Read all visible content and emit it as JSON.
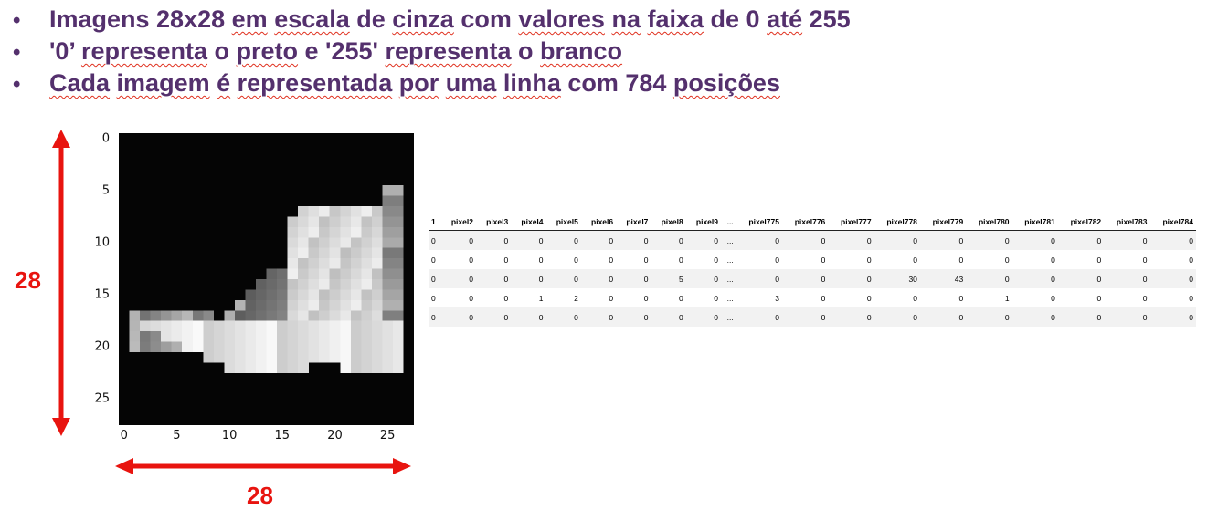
{
  "bullets": [
    {
      "marker": "•",
      "segments": [
        {
          "text": "Imagens 28x28 ",
          "flag": false
        },
        {
          "text": "em",
          "flag": true
        },
        {
          "text": " ",
          "flag": false
        },
        {
          "text": "escala",
          "flag": true
        },
        {
          "text": " de ",
          "flag": false
        },
        {
          "text": "cinza",
          "flag": true
        },
        {
          "text": " com ",
          "flag": false
        },
        {
          "text": "valores",
          "flag": true
        },
        {
          "text": " ",
          "flag": false
        },
        {
          "text": "na",
          "flag": true
        },
        {
          "text": " ",
          "flag": false
        },
        {
          "text": "faixa",
          "flag": true
        },
        {
          "text": " de 0 ",
          "flag": false
        },
        {
          "text": "até",
          "flag": true
        },
        {
          "text": " 255",
          "flag": false
        }
      ]
    },
    {
      "marker": "•",
      "segments": [
        {
          "text": "'0’ ",
          "flag": false
        },
        {
          "text": "representa",
          "flag": true
        },
        {
          "text": " o ",
          "flag": false
        },
        {
          "text": "preto",
          "flag": true
        },
        {
          "text": " e '255' ",
          "flag": false
        },
        {
          "text": "representa",
          "flag": true
        },
        {
          "text": " o ",
          "flag": false
        },
        {
          "text": "branco",
          "flag": true
        }
      ]
    },
    {
      "marker": "•",
      "segments": [
        {
          "text": "Cada",
          "flag": true
        },
        {
          "text": " ",
          "flag": false
        },
        {
          "text": "imagem",
          "flag": true
        },
        {
          "text": " ",
          "flag": false
        },
        {
          "text": "é",
          "flag": true
        },
        {
          "text": " ",
          "flag": false
        },
        {
          "text": "representada",
          "flag": true
        },
        {
          "text": " ",
          "flag": false
        },
        {
          "text": "por",
          "flag": true
        },
        {
          "text": " ",
          "flag": false
        },
        {
          "text": "uma",
          "flag": true
        },
        {
          "text": " ",
          "flag": false
        },
        {
          "text": "linha",
          "flag": true
        },
        {
          "text": " com 784 ",
          "flag": false
        },
        {
          "text": "posições",
          "flag": true
        }
      ]
    }
  ],
  "image_plot": {
    "y_ticks": [
      "0",
      "5",
      "10",
      "15",
      "20",
      "25"
    ],
    "x_ticks": [
      "0",
      "5",
      "10",
      "15",
      "20",
      "25"
    ],
    "height_label": "28",
    "width_label": "28",
    "arrow_color": "#e8140f"
  },
  "pixel_table": {
    "columns": [
      "1",
      "pixel2",
      "pixel3",
      "pixel4",
      "pixel5",
      "pixel6",
      "pixel7",
      "pixel8",
      "pixel9",
      "...",
      "pixel775",
      "pixel776",
      "pixel777",
      "pixel778",
      "pixel779",
      "pixel780",
      "pixel781",
      "pixel782",
      "pixel783",
      "pixel784"
    ],
    "rows": [
      [
        "0",
        "0",
        "0",
        "0",
        "0",
        "0",
        "0",
        "0",
        "0",
        "...",
        "0",
        "0",
        "0",
        "0",
        "0",
        "0",
        "0",
        "0",
        "0",
        "0"
      ],
      [
        "0",
        "0",
        "0",
        "0",
        "0",
        "0",
        "0",
        "0",
        "0",
        "...",
        "0",
        "0",
        "0",
        "0",
        "0",
        "0",
        "0",
        "0",
        "0",
        "0"
      ],
      [
        "0",
        "0",
        "0",
        "0",
        "0",
        "0",
        "0",
        "5",
        "0",
        "...",
        "0",
        "0",
        "0",
        "30",
        "43",
        "0",
        "0",
        "0",
        "0",
        "0"
      ],
      [
        "0",
        "0",
        "0",
        "1",
        "2",
        "0",
        "0",
        "0",
        "0",
        "...",
        "3",
        "0",
        "0",
        "0",
        "0",
        "1",
        "0",
        "0",
        "0",
        "0"
      ],
      [
        "0",
        "0",
        "0",
        "0",
        "0",
        "0",
        "0",
        "0",
        "0",
        "...",
        "0",
        "0",
        "0",
        "0",
        "0",
        "0",
        "0",
        "0",
        "0",
        "0"
      ]
    ]
  },
  "colors": {
    "bullet_text": "#54306d",
    "spell_underline": "#e0301e",
    "arrow": "#e8140f"
  }
}
